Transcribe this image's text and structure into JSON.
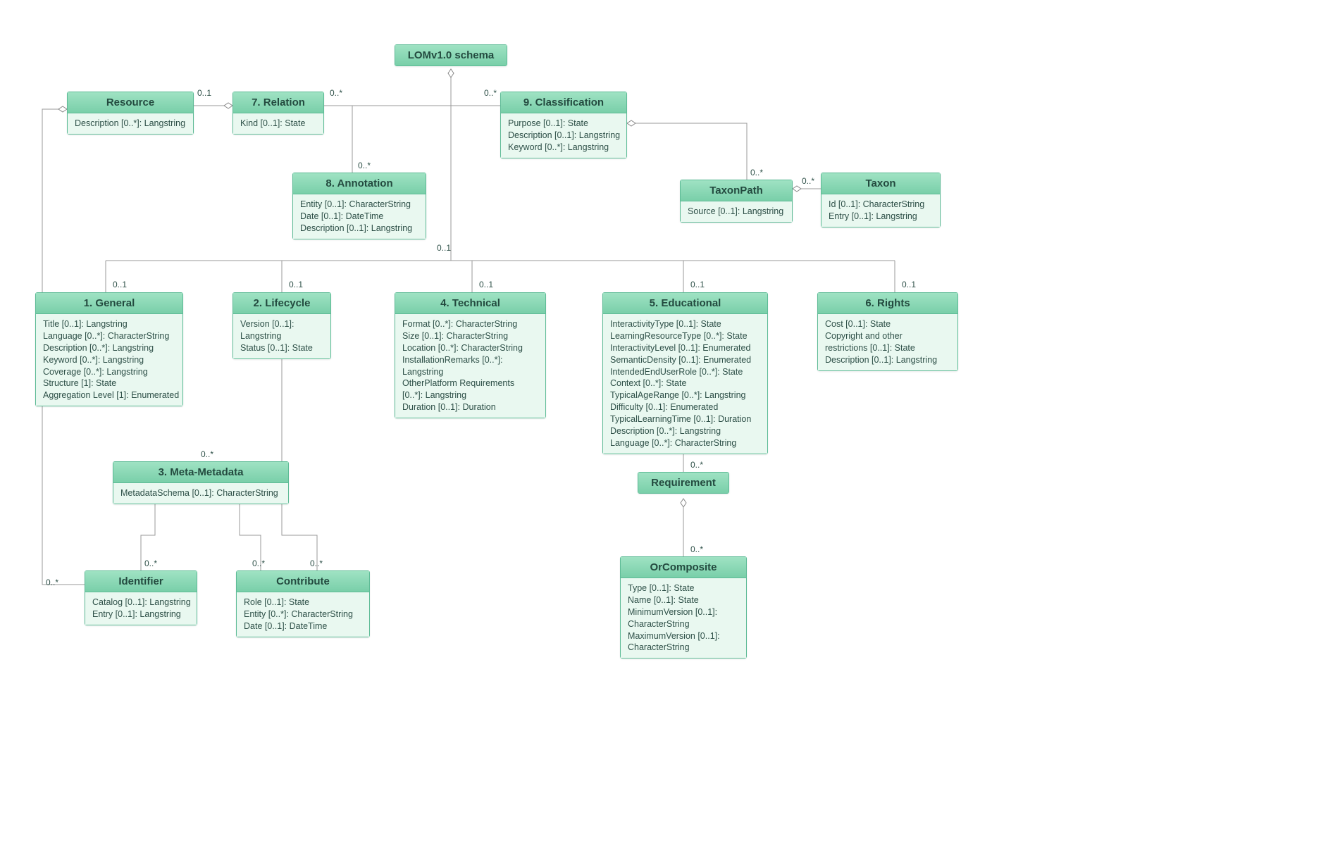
{
  "root": {
    "title": "LOMv1.0 schema"
  },
  "resource": {
    "title": "Resource",
    "attrs": [
      "Description [0..*]: Langstring"
    ]
  },
  "relation": {
    "title": "7. Relation",
    "attrs": [
      "Kind [0..1]: State"
    ]
  },
  "classification": {
    "title": "9. Classification",
    "attrs": [
      "Purpose [0..1]: State",
      "Description [0..1]: Langstring",
      "Keyword [0..*]: Langstring"
    ]
  },
  "annotation": {
    "title": "8. Annotation",
    "attrs": [
      "Entity [0..1]: CharacterString",
      "Date [0..1]: DateTime",
      "Description [0..1]: Langstring"
    ]
  },
  "taxonpath": {
    "title": "TaxonPath",
    "attrs": [
      "Source [0..1]: Langstring"
    ]
  },
  "taxon": {
    "title": "Taxon",
    "attrs": [
      "Id [0..1]: CharacterString",
      "Entry [0..1]: Langstring"
    ]
  },
  "general": {
    "title": "1. General",
    "attrs": [
      "Title [0..1]: Langstring",
      "Language [0..*]: CharacterString",
      "Description [0..*]: Langstring",
      "Keyword [0..*]: Langstring",
      "Coverage [0..*]: Langstring",
      "Structure [1]: State",
      "Aggregation Level [1]: Enumerated"
    ]
  },
  "lifecycle": {
    "title": "2. Lifecycle",
    "attrs": [
      "Version [0..1]:",
      "Langstring",
      "Status [0..1]: State"
    ]
  },
  "technical": {
    "title": "4. Technical",
    "attrs": [
      "Format [0..*]: CharacterString",
      "Size [0..1]: CharacterString",
      "Location [0..*]: CharacterString",
      "InstallationRemarks [0..*]:",
      "Langstring",
      "OtherPlatform Requirements",
      "[0..*]: Langstring",
      "Duration [0..1]: Duration"
    ]
  },
  "educational": {
    "title": "5. Educational",
    "attrs": [
      "InteractivityType [0..1]: State",
      "LearningResourceType [0..*]: State",
      "InteractivityLevel [0..1]: Enumerated",
      "SemanticDensity [0..1]: Enumerated",
      "IntendedEndUserRole [0..*]: State",
      "Context [0..*]: State",
      "TypicalAgeRange [0..*]: Langstring",
      "Difficulty [0..1]: Enumerated",
      "TypicalLearningTime [0..1]: Duration",
      "Description [0..*]: Langstring",
      "Language [0..*]: CharacterString"
    ]
  },
  "rights": {
    "title": "6. Rights",
    "attrs": [
      "Cost [0..1]: State",
      "Copyright and other",
      "restrictions [0..1]: State",
      "Description [0..1]: Langstring"
    ]
  },
  "metametadata": {
    "title": "3. Meta-Metadata",
    "attrs": [
      "MetadataSchema [0..1]: CharacterString"
    ]
  },
  "identifier": {
    "title": "Identifier",
    "attrs": [
      "Catalog [0..1]: Langstring",
      "Entry [0..1]: Langstring"
    ]
  },
  "contribute": {
    "title": "Contribute",
    "attrs": [
      "Role [0..1]: State",
      "Entity [0..*]: CharacterString",
      "Date [0..1]: DateTime"
    ]
  },
  "requirement": {
    "title": "Requirement"
  },
  "orcomposite": {
    "title": "OrComposite",
    "attrs": [
      "Type [0..1]: State",
      "Name [0..1]: State",
      "MinimumVersion [0..1]:",
      "CharacterString",
      "MaximumVersion [0..1]:",
      "CharacterString"
    ]
  },
  "mults": {
    "m_rel_res": "0..1",
    "m_root_rel": "0..*",
    "m_root_class": "0..*",
    "m_rel_ann": "0..*",
    "m_class_tp": "0..*",
    "m_tp_tax": "0..*",
    "m_mid": "0..1",
    "m_general": "0..1",
    "m_lifecycle": "0..1",
    "m_technical": "0..1",
    "m_educational": "0..1",
    "m_rights": "0..1",
    "m_mm": "0..*",
    "m_id1": "0..*",
    "m_id2": "0..*",
    "m_contrib1": "0..*",
    "m_contrib2": "0..*",
    "m_req": "0..*",
    "m_orc": "0..*"
  }
}
